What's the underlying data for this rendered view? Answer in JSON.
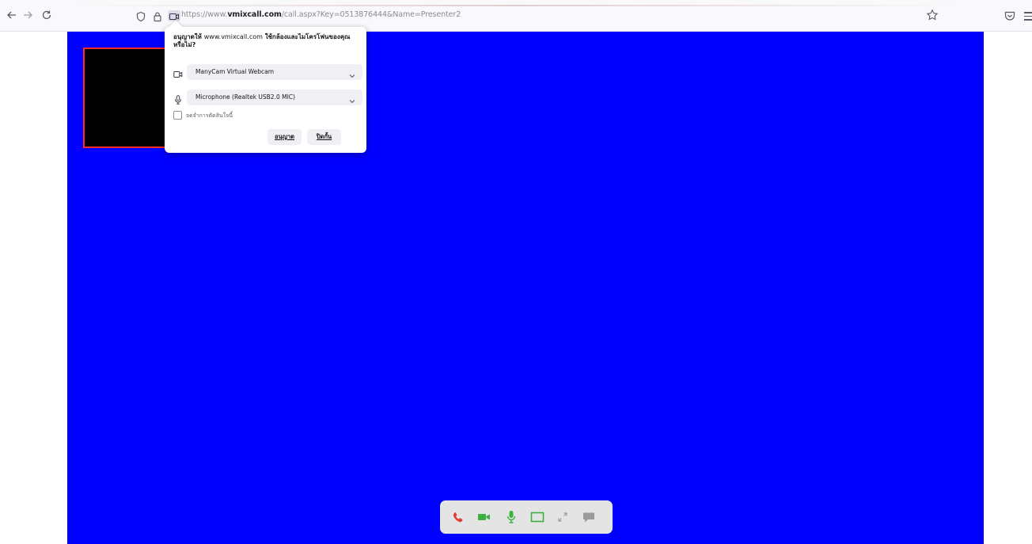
{
  "browser": {
    "url_prefix": "https://www.",
    "url_domain": "vmixcall.com",
    "url_path": "/call.aspx?Key=0513876444&Name=Presenter2"
  },
  "permission_popup": {
    "title_part1": "อนุญาตให้ ",
    "title_host": "www.vmixcall.com",
    "title_part2": " ใช้กล้องและไมโครโฟนของคุณหรือไม่?",
    "camera_device": "ManyCam Virtual Webcam",
    "microphone_device": "Microphone (Realtek USB2.0 MIC)",
    "remember_label": "จดจำการตัดสินใจนี้",
    "allow_label": "อนุญาต",
    "block_label": "ปิดกั้น"
  },
  "call": {
    "stage_color": "#0000ff",
    "preview_border_color": "#ff2a2a",
    "control_color": "#3cb043",
    "hangup_color": "#e53935",
    "controls": [
      "hangup-icon",
      "camera-icon",
      "microphone-icon",
      "screen-share-icon",
      "expand-icon",
      "chat-icon"
    ]
  }
}
